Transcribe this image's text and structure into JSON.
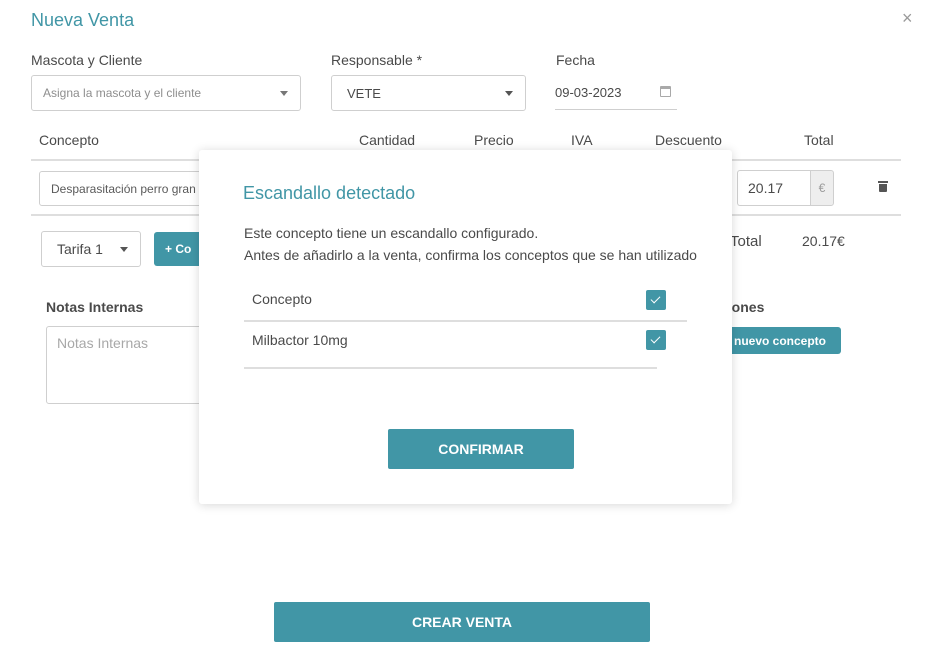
{
  "header": {
    "title": "Nueva Venta",
    "close_icon": "×"
  },
  "form": {
    "mascota_label": "Mascota y Cliente",
    "mascota_placeholder": "Asigna la mascota y el cliente",
    "responsable_label": "Responsable *",
    "responsable_value": "VETE",
    "fecha_label": "Fecha",
    "fecha_value": "09-03-2023"
  },
  "table": {
    "headers": [
      "Concepto",
      "Cantidad",
      "Precio",
      "IVA",
      "Descuento",
      "Total"
    ],
    "row": {
      "concepto": "Desparasitación perro gran",
      "total": "20.17",
      "currency": "€"
    }
  },
  "footer_row": {
    "tarifa": "Tarifa 1",
    "add_concept_label": "+ Co",
    "total_label": "Total",
    "total_value": "20.17€"
  },
  "notes": {
    "title": "Notas Internas",
    "placeholder": "Notas Internas"
  },
  "sugerencias": {
    "title_partial": "ciones",
    "button": "nuevo concepto"
  },
  "actions": {
    "create": "CREAR VENTA"
  },
  "modal": {
    "title": "Escandallo detectado",
    "line1": "Este concepto tiene un escandallo configurado.",
    "line2": "Antes de añadirlo a la venta, confirma los conceptos que se han utilizado",
    "header": "Concepto",
    "items": [
      {
        "label": "Milbactor 10mg",
        "checked": true
      }
    ],
    "confirm": "CONFIRMAR"
  },
  "colors": {
    "accent": "#4196a6",
    "border": "#cfcfcf",
    "divider": "#dedede"
  }
}
